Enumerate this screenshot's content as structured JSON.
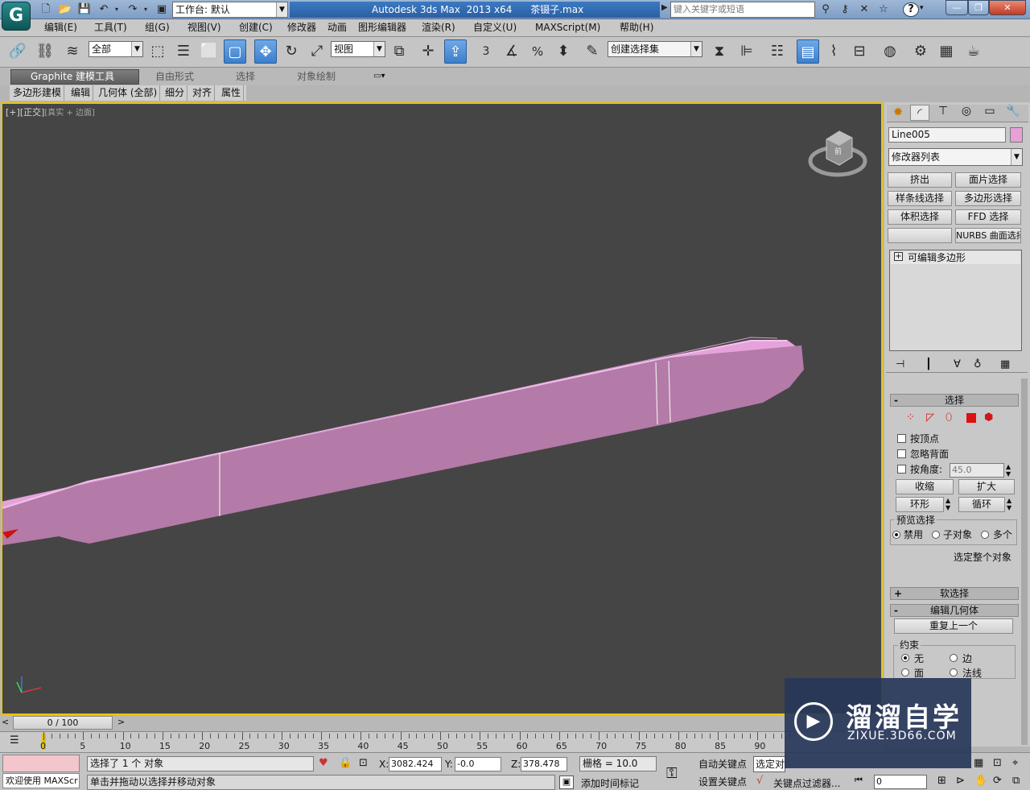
{
  "app": {
    "logo_letter": "G",
    "workspace": "工作台: 默认",
    "title": "Autodesk 3ds Max  2013 x64      茶镊子.max",
    "search_placeholder": "键入关键字或短语",
    "help": "?"
  },
  "menu": [
    "编辑(E)",
    "工具(T)",
    "组(G)",
    "视图(V)",
    "创建(C)",
    "修改器",
    "动画",
    "图形编辑器",
    "渲染(R)",
    "自定义(U)",
    "MAXScript(M)",
    "帮助(H)"
  ],
  "toolbar": {
    "selection_filter": "全部",
    "reference_coord": "视图",
    "named_selection": "创建选择集",
    "snap_label": "3",
    "percent_label": "%"
  },
  "ribbon": {
    "tabs": [
      "Graphite 建模工具",
      "自由形式",
      "选择",
      "对象绘制"
    ],
    "subtabs": [
      "多边形建模",
      "编辑",
      "几何体 (全部)",
      "细分",
      "对齐",
      "属性"
    ]
  },
  "viewport": {
    "label_bracket": "[+]",
    "label_view": "[正交]",
    "label_shading": "[真实 + 边面]",
    "viewcube_text": "前",
    "object_color": "#b47aa8",
    "object_top_color": "#e5a3da"
  },
  "panel": {
    "object_name": "Line005",
    "object_swatch": "#e8a0d8",
    "modifier_list": "修改器列表",
    "modifier_buttons": [
      "挤出",
      "面片选择",
      "样条线选择",
      "多边形选择",
      "体积选择",
      "FFD 选择",
      "",
      "NURBS 曲面选择"
    ],
    "stack_item": "可编辑多边形",
    "selection": {
      "title": "选择",
      "by_vertex": "按顶点",
      "ignore_backface": "忽略背面",
      "by_angle": "按角度:",
      "angle_value": "45.0",
      "shrink": "收缩",
      "grow": "扩大",
      "ring": "环形",
      "loop": "循环",
      "preview_title": "预览选择",
      "preview_options": [
        "禁用",
        "子对象",
        "多个"
      ],
      "select_whole": "选定整个对象"
    },
    "soft_selection": "软选择",
    "edit_geometry": "编辑几何体",
    "repeat_last": "重复上一个",
    "constraints": {
      "title": "约束",
      "options": [
        "无",
        "边",
        "面",
        "法线"
      ]
    }
  },
  "timeline": {
    "frame_counter": "0 / 100",
    "ticks": [
      "0",
      "5",
      "10",
      "15",
      "20",
      "25",
      "30",
      "35",
      "40",
      "45",
      "50",
      "55",
      "60",
      "65",
      "70",
      "75",
      "80",
      "85",
      "90"
    ]
  },
  "status": {
    "maxscript": "欢迎使用 MAXScr",
    "selected": "选择了 1 个 对象",
    "prompt": "单击并拖动以选择并移动对象",
    "x_label": "X:",
    "x_value": "3082.424",
    "y_label": "Y:",
    "y_value": "-0.0",
    "z_label": "Z:",
    "z_value": "378.478",
    "grid": "栅格 = 10.0",
    "add_time_tag": "添加时间标记",
    "auto_key": "自动关键点",
    "set_key": "设置关键点",
    "selected_obj": "选定对",
    "key_filters": "关键点过滤器...",
    "frame_value": "0"
  },
  "watermark": {
    "title": "溜溜自学",
    "url": "ZIXUE.3D66.COM"
  }
}
